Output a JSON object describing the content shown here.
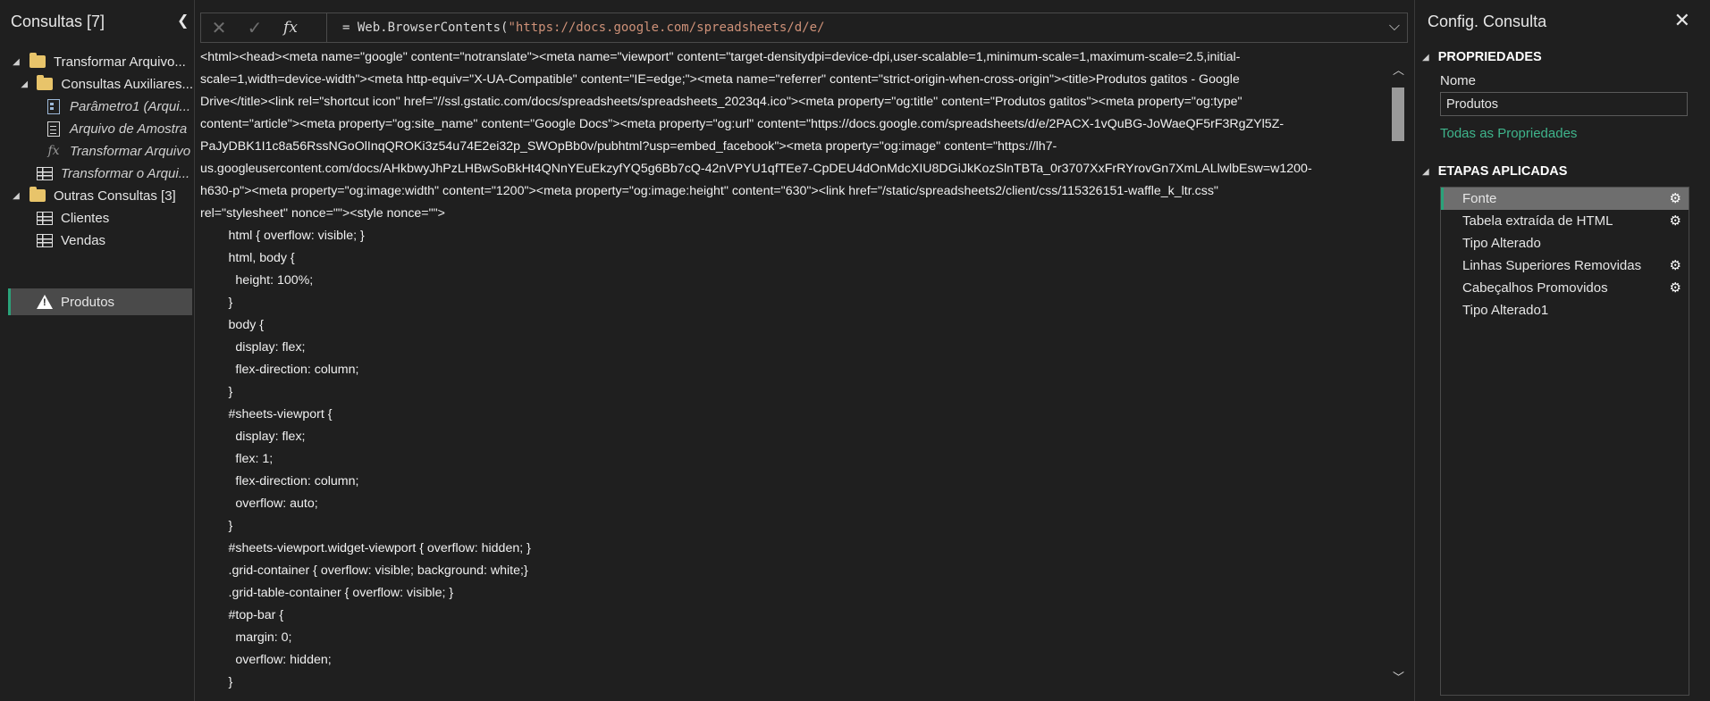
{
  "left_panel": {
    "header": "Consultas [7]",
    "collapse_glyph": "❮",
    "items": [
      {
        "label": "Transformar Arquivo...",
        "icon": "folder-icon",
        "expanded": true
      },
      {
        "label": "Consultas Auxiliares...",
        "icon": "folder-icon",
        "expanded": true
      },
      {
        "label": "Parâmetro1 (Arqui...",
        "icon": "parameter-icon"
      },
      {
        "label": "Arquivo de Amostra",
        "icon": "document-icon"
      },
      {
        "label": "Transformar Arquivo",
        "icon": "function-icon"
      },
      {
        "label": "Transformar o Arqui...",
        "icon": "table-icon"
      },
      {
        "label": "Outras Consultas [3]",
        "icon": "folder-icon",
        "expanded": true
      },
      {
        "label": "Clientes",
        "icon": "table-icon"
      },
      {
        "label": "Vendas",
        "icon": "table-icon"
      },
      {
        "label": "Produtos",
        "icon": "warning-icon",
        "selected": true
      }
    ]
  },
  "formula_bar": {
    "cancel_glyph": "✕",
    "commit_glyph": "✓",
    "fx_glyph": "fx",
    "prefix": "= Web.BrowserContents(",
    "string": "\"https://docs.google.com/spreadsheets/d/e/",
    "expand_glyph": "⌵"
  },
  "content_lines": [
    "<html><head><meta name=\"google\" content=\"notranslate\"><meta name=\"viewport\" content=\"target-densitydpi=device-dpi,user-scalable=1,minimum-scale=1,maximum-scale=2.5,initial-",
    "scale=1,width=device-width\"><meta http-equiv=\"X-UA-Compatible\" content=\"IE=edge;\"><meta name=\"referrer\" content=\"strict-origin-when-cross-origin\"><title>Produtos gatitos - Google",
    "Drive</title><link rel=\"shortcut icon\" href=\"//ssl.gstatic.com/docs/spreadsheets/spreadsheets_2023q4.ico\"><meta property=\"og:title\" content=\"Produtos gatitos\"><meta property=\"og:type\"",
    "content=\"article\"><meta property=\"og:site_name\" content=\"Google Docs\"><meta property=\"og:url\" content=\"https://docs.google.com/spreadsheets/d/e/2PACX-1vQuBG-JoWaeQF5rF3RgZYl5Z-",
    "PaJyDBK1I1c8a56RssNGoOlInqQROKi3z54u74E2ei32p_SWOpBb0v/pubhtml?usp=embed_facebook\"><meta property=\"og:image\" content=\"https://lh7-",
    "us.googleusercontent.com/docs/AHkbwyJhPzLHBwSoBkHt4QNnYEuEkzyfYQ5g6Bb7cQ-42nVPYU1qfTEe7-CpDEU4dOnMdcXIU8DGiJkKozSlnTBTa_0r3707XxFrRYrovGn7XmLALlwlbEsw=w1200-",
    "h630-p\"><meta property=\"og:image:width\" content=\"1200\"><meta property=\"og:image:height\" content=\"630\"><link href=\"/static/spreadsheets2/client/css/115326151-waffle_k_ltr.css\"",
    "rel=\"stylesheet\" nonce=\"\"><style nonce=\"\">",
    "        html { overflow: visible; }",
    "        html, body {",
    "          height: 100%;",
    "        }",
    "        body {",
    "          display: flex;",
    "          flex-direction: column;",
    "        }",
    "        #sheets-viewport {",
    "          display: flex;",
    "          flex: 1;",
    "          flex-direction: column;",
    "          overflow: auto;",
    "        }",
    "        #sheets-viewport.widget-viewport { overflow: hidden; }",
    "        .grid-container { overflow: visible; background: white;}",
    "        .grid-table-container { overflow: visible; }",
    "        #top-bar {",
    "          margin: 0;",
    "          overflow: hidden;",
    "        }"
  ],
  "scrollbar": {
    "up_glyph": "︿",
    "down_glyph": "﹀"
  },
  "right_panel": {
    "title": "Config. Consulta",
    "close_glyph": "✕",
    "properties_heading": "PROPRIEDADES",
    "name_label": "Nome",
    "name_value": "Produtos",
    "all_properties_link": "Todas as Propriedades",
    "steps_heading": "ETAPAS APLICADAS",
    "steps": [
      {
        "label": "Fonte",
        "gear": true,
        "selected": true
      },
      {
        "label": "Tabela extraída de HTML",
        "gear": true
      },
      {
        "label": "Tipo Alterado",
        "gear": false
      },
      {
        "label": "Linhas Superiores Removidas",
        "gear": true
      },
      {
        "label": "Cabeçalhos Promovidos",
        "gear": true
      },
      {
        "label": "Tipo Alterado1",
        "gear": false
      }
    ]
  },
  "colors": {
    "accent": "#2aa37a",
    "link": "#3fb58c",
    "string": "#ce9178",
    "folder": "#e8c46a"
  }
}
